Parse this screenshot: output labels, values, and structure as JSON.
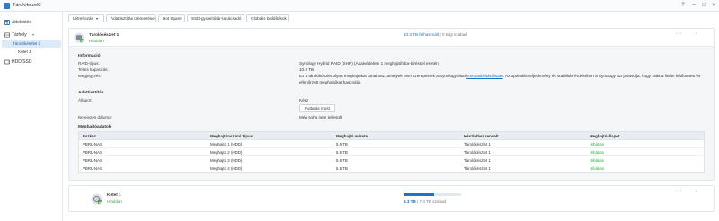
{
  "window": {
    "title": "Tárolókezelő"
  },
  "sidebar": {
    "overview": "Áttekintés",
    "storage": "Tárhely",
    "pool": "Tárolókészlet 1",
    "volume": "Kötet 1",
    "hdd": "HDD/SSD"
  },
  "toolbar": {
    "create": "Létrehozás",
    "remove_data": "Adattisztítás ütemezése",
    "hot_spare": "Hot Spare",
    "ssd_cache": "SSD-gyorsítótár-tanácsadó",
    "global_settings": "Globális beállítások"
  },
  "pool": {
    "name": "Tárolókészlet 1",
    "status": "Hibátlan",
    "used": "10.3 TB felhasznált",
    "separator": " | ",
    "free": "0 Bájt szabad",
    "more": "···",
    "info_title": "Információ",
    "raid_label": "RAID-típus:",
    "raid_value": "Synology Hybrid RAID (SHR) (Adatvédelem 1 meghajtóhiba-tűréssel esetén)",
    "capacity_label": "Teljes kapacitás:",
    "capacity_value": "10.3 TB",
    "note_label": "Megjegyzés:",
    "note_text_1": "Ez a tárolókészlet olyan meghajtókat tartalmaz, amelyek nem szerepelnek a Synology által ",
    "note_link": "kompatibilitási listán",
    "note_text_2": ". Az optimális teljesítmény és stabilitás érdekében a Synology azt javasolja, hogy csak a listán feltűntetett és",
    "note_text_3": "ellenőrzött meghajtókat használja.",
    "scrub_title": "Adattisztítás",
    "state_label": "Állapot:",
    "state_value": "Kész",
    "run_button": "Futtatás most",
    "date_label": "Befejezés dátuma:",
    "date_value": "Még soha nem teljesült",
    "drive_info_title": "Meghajtóadatok",
    "table": {
      "headers": [
        "Eszköz",
        "Meghajtónszám/ Típus",
        "Meghajtó mérete",
        "Készlethez rendelt",
        "Meghajtóállapot"
      ],
      "rows": [
        [
          "VBRL-NAS",
          "Meghajtó 1 (HDD)",
          "5.5 TB",
          "Tárolókészlet 1",
          "Hibátlan"
        ],
        [
          "VBRL-NAS",
          "Meghajtó 2 (HDD)",
          "5.5 TB",
          "Tárolókészlet 1",
          "Hibátlan"
        ],
        [
          "VBRL-NAS",
          "Meghajtó 3 (HDD)",
          "5.5 TB",
          "Tárolókészlet 1",
          "Hibátlan"
        ],
        [
          "VBRL-NAS",
          "Meghajtó 4 (HDD)",
          "5.5 TB",
          "Tárolókészlet 1",
          "Hibátlan"
        ]
      ]
    }
  },
  "volume": {
    "name": "Kötet 1",
    "status": "Hibátlan",
    "used": "8.3 TB",
    "separator": " | ",
    "total": "7.4 TB szabad",
    "usage_fraction": 0.53,
    "more": "···"
  },
  "colors": {
    "accent": "#1a73c9",
    "healthy": "#3aa845",
    "selected_bg": "#dbe9f8"
  }
}
